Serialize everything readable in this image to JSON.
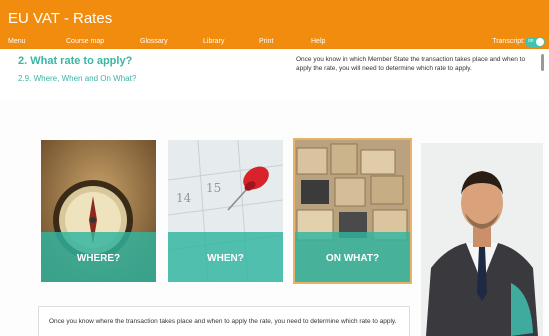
{
  "app": {
    "title": "EU VAT - Rates"
  },
  "menu": {
    "items": [
      "Menu",
      "Course map",
      "Glossary",
      "Library",
      "Print",
      "Help"
    ]
  },
  "transcript": {
    "label": "Transcript:",
    "state": "on"
  },
  "header": {
    "title": "2. What rate to apply?",
    "subtitle": "2.9. Where, When and On What?",
    "intro": "Once you know in which Member State the transaction takes place and when to apply the rate, you will need to determine which rate to apply."
  },
  "cards": [
    {
      "label": "WHERE?",
      "image": "compass"
    },
    {
      "label": "WHEN?",
      "image": "calendar-pin"
    },
    {
      "label": "ON WHAT?",
      "image": "boxes"
    }
  ],
  "bottom": {
    "text": "Once you know where the transaction takes place and when to apply the rate, you need to determine which rate to apply."
  },
  "colors": {
    "brand": "#f28c0f",
    "accent": "#3bb5a4",
    "band": "#2fb4a0"
  }
}
